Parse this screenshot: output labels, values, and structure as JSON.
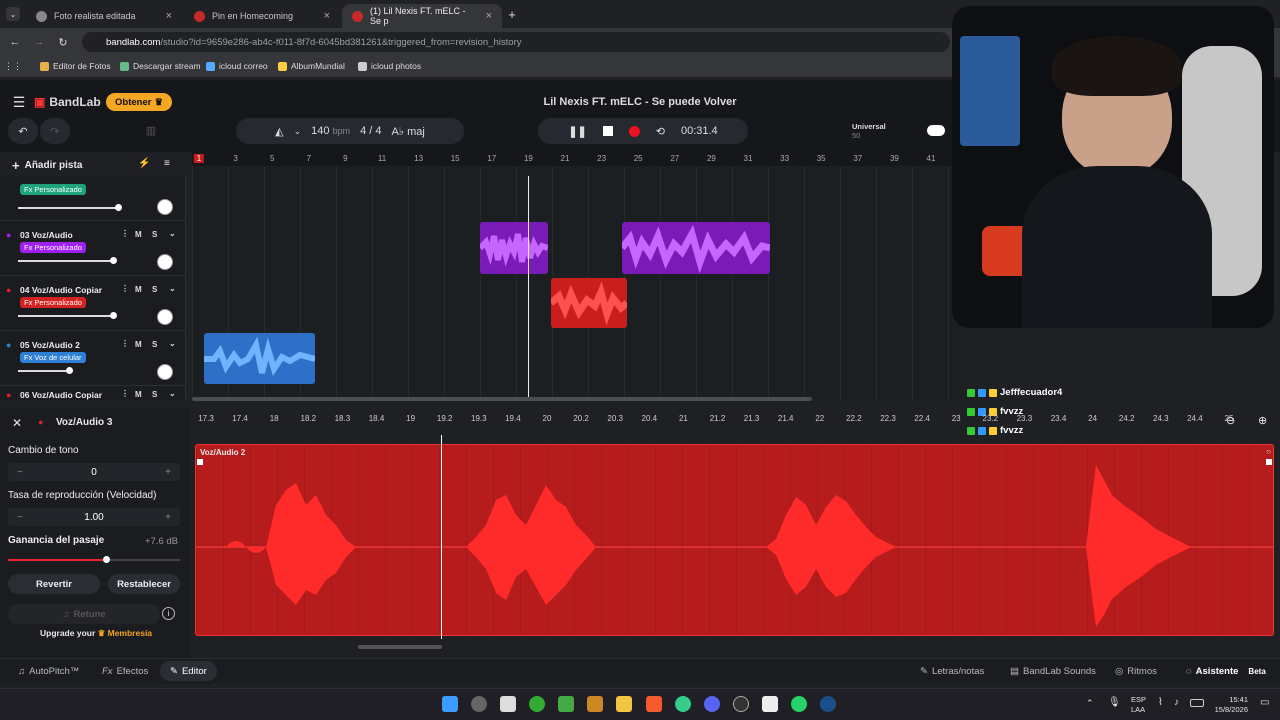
{
  "browser": {
    "tabs": [
      {
        "title": "Foto realista editada",
        "active": false
      },
      {
        "title": "Pin en Homecoming",
        "active": false
      },
      {
        "title": "(1) Lil Nexis FT. mELC - Se p",
        "active": true
      }
    ],
    "url_host": "bandlab.com",
    "url_path": "/studio?id=9659e286-ab4c-f011-8f7d-6045bd381261&triggered_from=revision_history",
    "bookmarks": [
      "Editor de Fotos",
      "Descargar stream",
      "icloud correo",
      "AlbumMundial",
      "icloud photos"
    ]
  },
  "app": {
    "logo": "BandLab",
    "obtener": "Obtener",
    "project_title": "Lil Nexis FT. mELC - Se puede Volver",
    "bpm_value": "140",
    "bpm_unit": "bpm",
    "time_sig": "4 / 4",
    "key": "A♭ maj",
    "time": "00:31.4",
    "preset_name": "Universal",
    "preset_value": "50",
    "add_track": "Añadir pista"
  },
  "ruler": [
    "1",
    "3",
    "5",
    "7",
    "9",
    "11",
    "13",
    "15",
    "17",
    "19",
    "21",
    "23",
    "25",
    "27",
    "29",
    "31",
    "33",
    "35",
    "37",
    "39",
    "41"
  ],
  "tracks": [
    {
      "name": "",
      "fx": "Fx Personalizado",
      "fx_color": "#1fa37a"
    },
    {
      "name": "03 Voz/Audio",
      "fx": "Fx Personalizado",
      "fx_color": "#a020f0"
    },
    {
      "name": "04 Voz/Audio Copiar",
      "fx": "Fx Personalizado",
      "fx_color": "#d32222"
    },
    {
      "name": "05 Voz/Audio 2",
      "fx": "Fx Voz de celular",
      "fx_color": "#2e7fd6"
    },
    {
      "name": "06 Voz/Audio Copiar",
      "fx": "",
      "fx_color": "#d32222"
    }
  ],
  "mute_label": "M",
  "solo_label": "S",
  "mid_ruler": [
    "17.3",
    "17.4",
    "18",
    "18.2",
    "18.3",
    "18.4",
    "19",
    "19.2",
    "19.3",
    "19.4",
    "20",
    "20.2",
    "20.3",
    "20.4",
    "21",
    "21.2",
    "21.3",
    "21.4",
    "22",
    "22.2",
    "22.3",
    "22.4",
    "23",
    "23.2",
    "23.3",
    "23.4",
    "24",
    "24.2",
    "24.3",
    "24.4",
    "25"
  ],
  "editor": {
    "track_name": "Voz/Audio 3",
    "clip_name": "Voz/Audio 2",
    "pitch_label": "Cambio de tono",
    "pitch_value": "0",
    "rate_label": "Tasa de reproducción (Velocidad)",
    "rate_value": "1.00",
    "gain_label": "Ganancia del pasaje",
    "gain_value": "+7.6 dB",
    "gain_level": 0.57,
    "revert": "Revertir",
    "reset": "Restablecer",
    "retune": "Retune",
    "upgrade_prefix": "Upgrade your",
    "upgrade_link": "Membresía"
  },
  "footer": {
    "left": [
      "AutoPitch™",
      "Efectos",
      "Editor"
    ],
    "right": [
      "Letras/notas",
      "BandLab Sounds",
      "Ritmos",
      "Asistente"
    ],
    "beta": "Beta"
  },
  "chat": [
    {
      "user": "Jefffecuador4"
    },
    {
      "user": "fvvzz"
    },
    {
      "user": "fvvzz"
    }
  ],
  "taskbar": {
    "lang1": "ESP",
    "lang2": "LAA",
    "time": "15:41",
    "date": "15/8/2026"
  }
}
